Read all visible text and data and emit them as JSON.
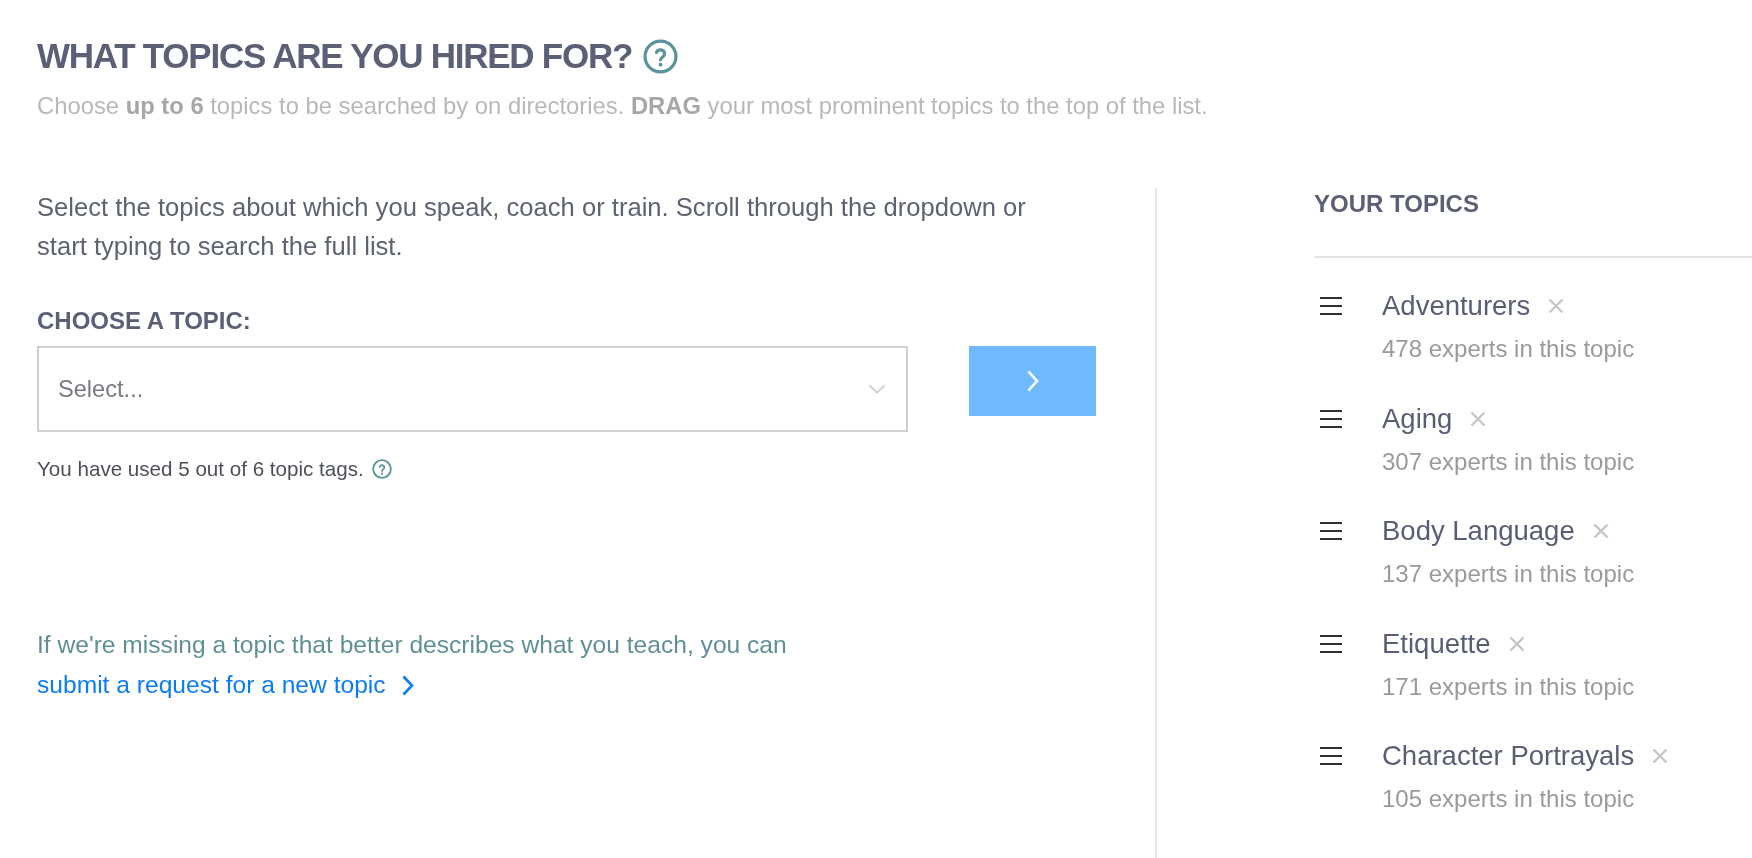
{
  "header": {
    "title": "WHAT TOPICS ARE YOU HIRED FOR?",
    "subtitle": "Choose **up to 6** topics to be searched by on directories. **DRAG** your most prominent topics to the top of the list."
  },
  "chooser": {
    "intro": "Select the topics about which you speak, coach or train. Scroll through the dropdown or start typing to search the full list.",
    "label": "CHOOSE A TOPIC:",
    "select": {
      "placeholder": "Select..."
    },
    "usage_note": "You have used 5 out of 6 topic tags.",
    "missing_note": {
      "text": "If we're missing a topic that better describes what you teach, you can",
      "link": "submit a request for a new topic"
    }
  },
  "your_topics": {
    "title": "YOUR TOPICS",
    "items": [
      {
        "name": "Adventurers",
        "count": "478 experts in this topic"
      },
      {
        "name": "Aging",
        "count": "307 experts in this topic"
      },
      {
        "name": "Body Language",
        "count": "137 experts in this topic"
      },
      {
        "name": "Etiquette",
        "count": "171 experts in this topic"
      },
      {
        "name": "Character Portrayals",
        "count": "105 experts in this topic"
      }
    ]
  }
}
